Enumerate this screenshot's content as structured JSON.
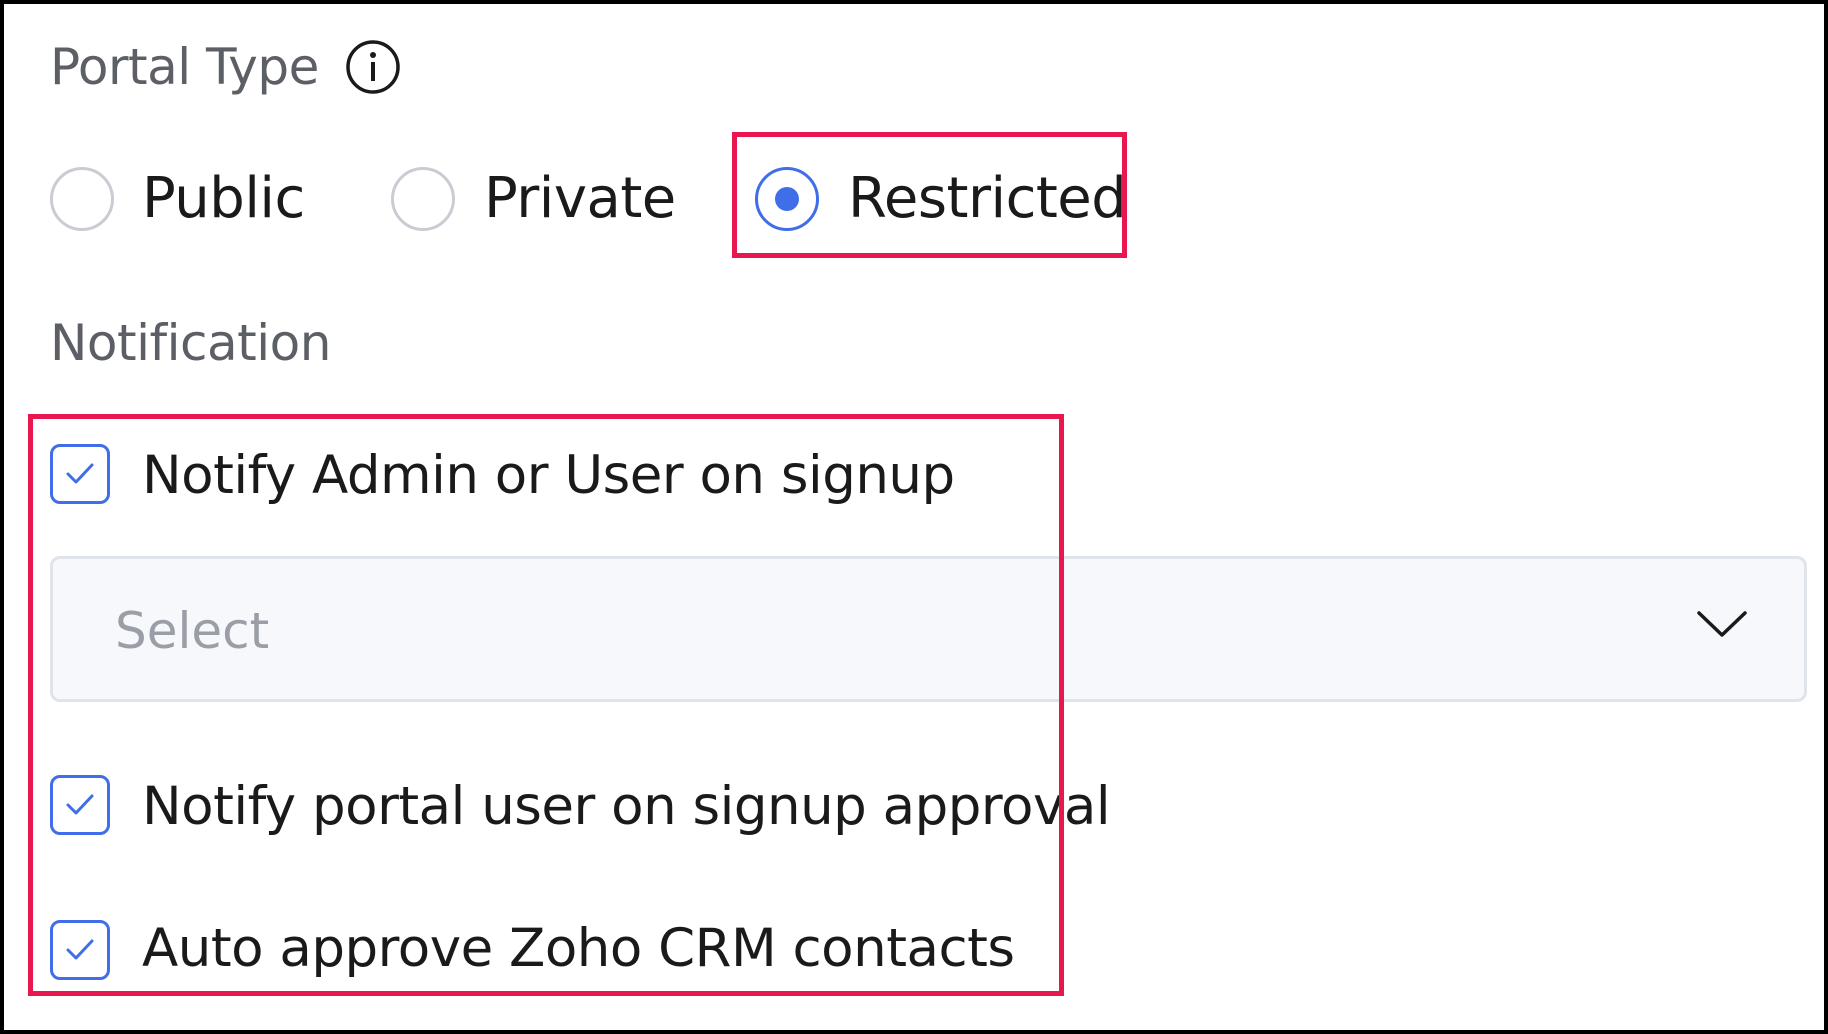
{
  "portal_type": {
    "title": "Portal Type",
    "info_icon": "info-circle-icon",
    "options": [
      {
        "label": "Public",
        "selected": false
      },
      {
        "label": "Private",
        "selected": false
      },
      {
        "label": "Restricted",
        "selected": true
      }
    ]
  },
  "notification": {
    "title": "Notification",
    "notify_admin": {
      "label": "Notify Admin or User on signup",
      "checked": true
    },
    "select": {
      "placeholder": "Select",
      "icon": "chevron-down-icon"
    },
    "notify_approval": {
      "label": "Notify portal user on signup approval",
      "checked": true
    },
    "auto_approve": {
      "label": "Auto approve Zoho CRM contacts",
      "checked": true
    }
  },
  "colors": {
    "accent": "#3f6ee8",
    "highlight": "#e8174f",
    "muted_text": "#5c5f66",
    "placeholder": "#9a9ea6"
  }
}
